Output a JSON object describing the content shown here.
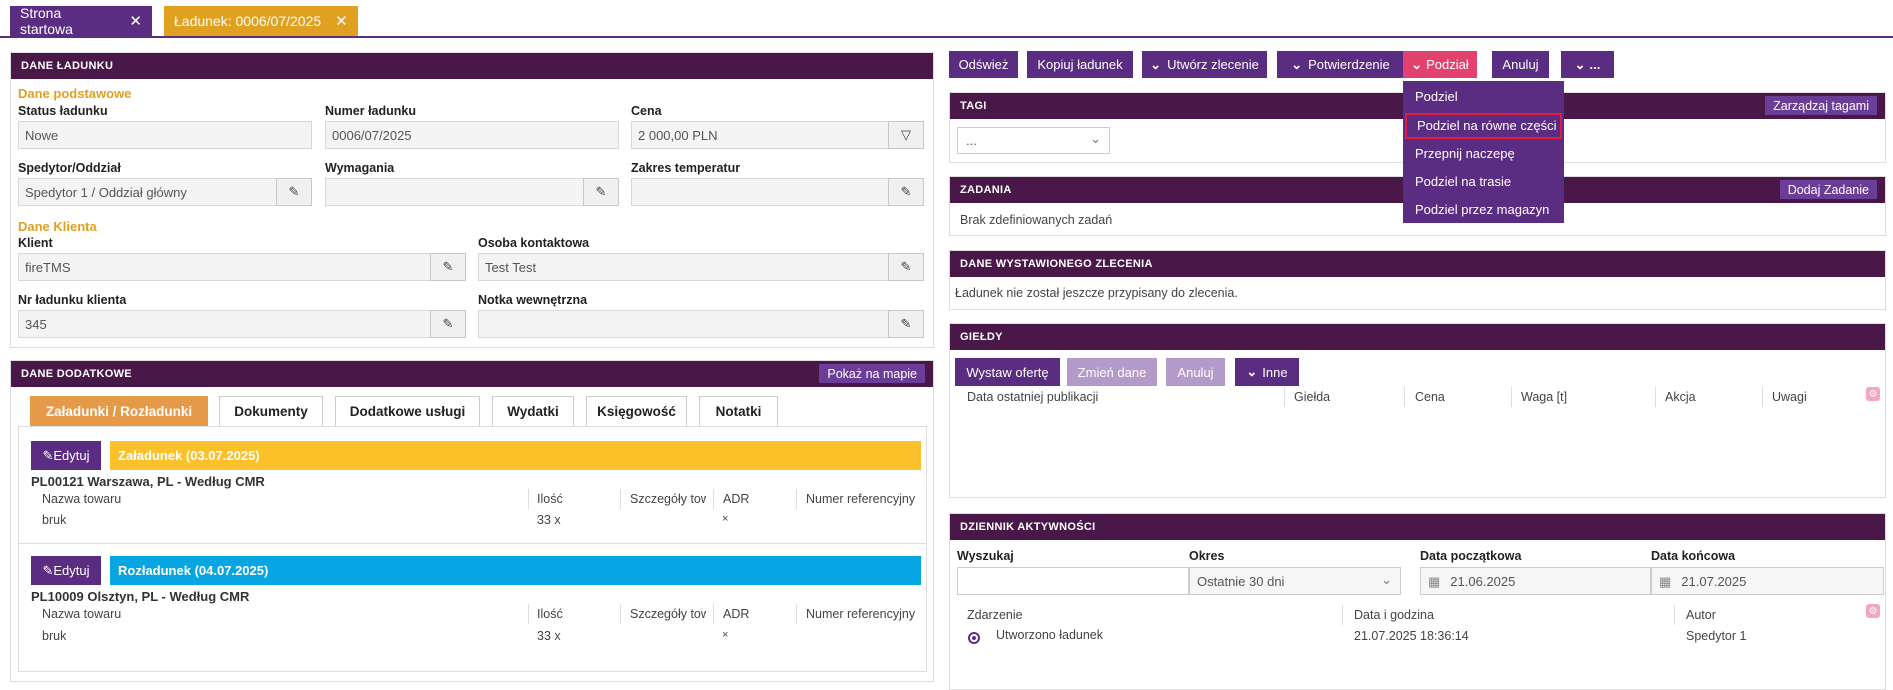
{
  "tabs": {
    "home": "Strona startowa",
    "load": "Ładunek: 0006/07/2025",
    "close": "✕"
  },
  "dane": {
    "header": "DANE ŁADUNKU",
    "basic": "Dane podstawowe",
    "status_label": "Status ładunku",
    "status": "Nowe",
    "number_label": "Numer ładunku",
    "number": "0006/07/2025",
    "price_label": "Cena",
    "price": "2 000,00 PLN",
    "spedytor_label": "Spedytor/Oddział",
    "spedytor": "Spedytor 1 / Oddział główny",
    "wymagania_label": "Wymagania",
    "wymagania": "",
    "temp_label": "Zakres temperatur",
    "temp": "",
    "client_section": "Dane Klienta",
    "client_label": "Klient",
    "client": "fireTMS",
    "contact_label": "Osoba kontaktowa",
    "contact": "Test Test",
    "client_no_label": "Nr ładunku klienta",
    "client_no": "345",
    "note_label": "Notka wewnętrzna",
    "note": ""
  },
  "extra": {
    "header": "DANE DODATKOWE",
    "map_btn": "Pokaż na mapie",
    "tabs": [
      "Załadunki / Rozładunki",
      "Dokumenty",
      "Dodatkowe usługi",
      "Wydatki",
      "Księgowość",
      "Notatki"
    ],
    "edit": "Edytuj",
    "cols": [
      "Nazwa towaru",
      "Ilość",
      "Szczegóły towaru",
      "ADR",
      "Numer referencyjny"
    ],
    "loading": {
      "title": "Załadunek (03.07.2025)",
      "address": "PL00121 Warszawa, PL - Według CMR",
      "item": "bruk",
      "qty": "33 x",
      "adr": "×"
    },
    "unloading": {
      "title": "Rozładunek (04.07.2025)",
      "address": "PL10009 Olsztyn, PL - Według CMR",
      "item": "bruk",
      "qty": "33 x",
      "adr": "×"
    }
  },
  "toolbar": {
    "refresh": "Odśwież",
    "copy": "Kopiuj ładunek",
    "create": "Utwórz zlecenie",
    "confirm": "Potwierdzenie",
    "split": "Podział",
    "cancel": "Anuluj",
    "more": "..."
  },
  "menu": {
    "items": [
      "Podziel",
      "Podziel na równe części",
      "Przepnij naczepę",
      "Podziel na trasie",
      "Podziel przez magazyn"
    ]
  },
  "tagi": {
    "header": "TAGI",
    "manage": "Zarządzaj tagami",
    "select": "..."
  },
  "zadania": {
    "header": "ZADANIA",
    "add": "Dodaj Zadanie",
    "empty": "Brak zdefiniowanych zadań"
  },
  "zlecenie": {
    "header": "DANE WYSTAWIONEGO ZLECENIA",
    "text": "Ładunek nie został jeszcze przypisany do zlecenia."
  },
  "gieldy": {
    "header": "GIEŁDY",
    "offer": "Wystaw ofertę",
    "change": "Zmień dane",
    "cancel": "Anuluj",
    "other": "Inne",
    "cols": [
      "Data ostatniej publikacji",
      "Giełda",
      "Cena",
      "Waga [t]",
      "Akcja",
      "Uwagi"
    ]
  },
  "dziennik": {
    "header": "DZIENNIK AKTYWNOŚCI",
    "search_label": "Wyszukaj",
    "period_label": "Okres",
    "period": "Ostatnie 30 dni",
    "start_label": "Data początkowa",
    "start": "21.06.2025",
    "end_label": "Data końcowa",
    "end": "21.07.2025",
    "cols": [
      "Zdarzenie",
      "Data i godzina",
      "Autor"
    ],
    "row": {
      "event": "Utworzono ładunek",
      "date": "21.07.2025 18:36:14",
      "author": "Spedytor 1"
    }
  },
  "colors": {
    "purple": "#5b2d82",
    "header": "#4a1848",
    "orange": "#e0a020",
    "pink": "#e2426e",
    "yellow": "#fcc02a",
    "blue": "#06a6e2"
  }
}
